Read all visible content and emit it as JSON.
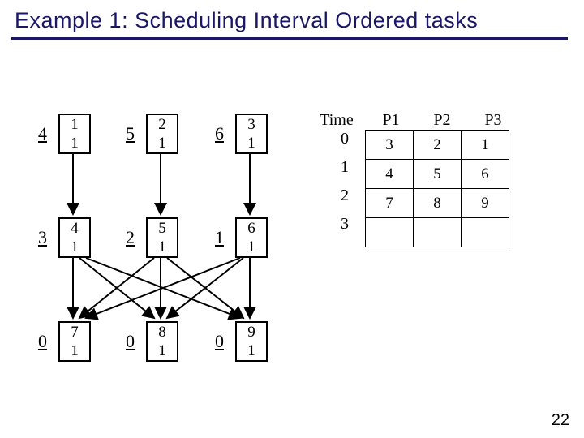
{
  "title": "Example 1: Scheduling Interval Ordered tasks",
  "page_number": "22",
  "nodes": {
    "n1": {
      "prio": "4",
      "id": "1",
      "w": "1"
    },
    "n2": {
      "prio": "5",
      "id": "2",
      "w": "1"
    },
    "n3": {
      "prio": "6",
      "id": "3",
      "w": "1"
    },
    "n4": {
      "prio": "3",
      "id": "4",
      "w": "1"
    },
    "n5": {
      "prio": "2",
      "id": "5",
      "w": "1"
    },
    "n6": {
      "prio": "1",
      "id": "6",
      "w": "1"
    },
    "n7": {
      "prio": "0",
      "id": "7",
      "w": "1"
    },
    "n8": {
      "prio": "0",
      "id": "8",
      "w": "1"
    },
    "n9": {
      "prio": "0",
      "id": "9",
      "w": "1"
    }
  },
  "schedule": {
    "time_label": "Time",
    "procs": [
      "P1",
      "P2",
      "P3"
    ],
    "times": [
      "0",
      "1",
      "2",
      "3"
    ],
    "rows": [
      [
        "3",
        "2",
        "1"
      ],
      [
        "4",
        "5",
        "6"
      ],
      [
        "7",
        "8",
        "9"
      ]
    ]
  },
  "chart_data": {
    "type": "table",
    "title": "Gantt / schedule for 3 processors",
    "columns": [
      "Time",
      "P1",
      "P2",
      "P3"
    ],
    "rows": [
      [
        "0",
        "3",
        "2",
        "1"
      ],
      [
        "1",
        "4",
        "5",
        "6"
      ],
      [
        "2",
        "7",
        "8",
        "9"
      ],
      [
        "3",
        "",
        "",
        ""
      ]
    ],
    "dag": {
      "nodes": [
        {
          "id": 1,
          "weight": 1,
          "priority": 4
        },
        {
          "id": 2,
          "weight": 1,
          "priority": 5
        },
        {
          "id": 3,
          "weight": 1,
          "priority": 6
        },
        {
          "id": 4,
          "weight": 1,
          "priority": 3
        },
        {
          "id": 5,
          "weight": 1,
          "priority": 2
        },
        {
          "id": 6,
          "weight": 1,
          "priority": 1
        },
        {
          "id": 7,
          "weight": 1,
          "priority": 0
        },
        {
          "id": 8,
          "weight": 1,
          "priority": 0
        },
        {
          "id": 9,
          "weight": 1,
          "priority": 0
        }
      ],
      "edges": [
        [
          1,
          4
        ],
        [
          2,
          5
        ],
        [
          3,
          6
        ],
        [
          4,
          7
        ],
        [
          4,
          8
        ],
        [
          4,
          9
        ],
        [
          5,
          7
        ],
        [
          5,
          8
        ],
        [
          5,
          9
        ],
        [
          6,
          7
        ],
        [
          6,
          8
        ],
        [
          6,
          9
        ]
      ]
    }
  }
}
